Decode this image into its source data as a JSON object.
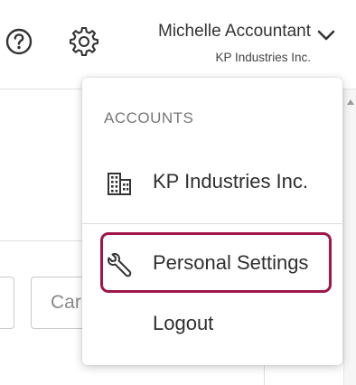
{
  "header": {
    "help_icon": "question-circle-icon",
    "settings_icon": "gear-icon",
    "user_name": "Michelle Accountant",
    "company_name": "KP Industries Inc.",
    "dropdown_icon": "chevron-down-icon"
  },
  "background": {
    "cancel_button_partial": "Car"
  },
  "dropdown": {
    "section_label": "ACCOUNTS",
    "items": [
      {
        "label": "KP Industries Inc.",
        "icon": "building-icon"
      },
      {
        "label": "Personal Settings",
        "icon": "wrench-icon",
        "highlighted": true
      },
      {
        "label": "Logout"
      }
    ]
  },
  "colors": {
    "highlight": "#a0154a",
    "text": "#333333",
    "muted": "#777777"
  }
}
